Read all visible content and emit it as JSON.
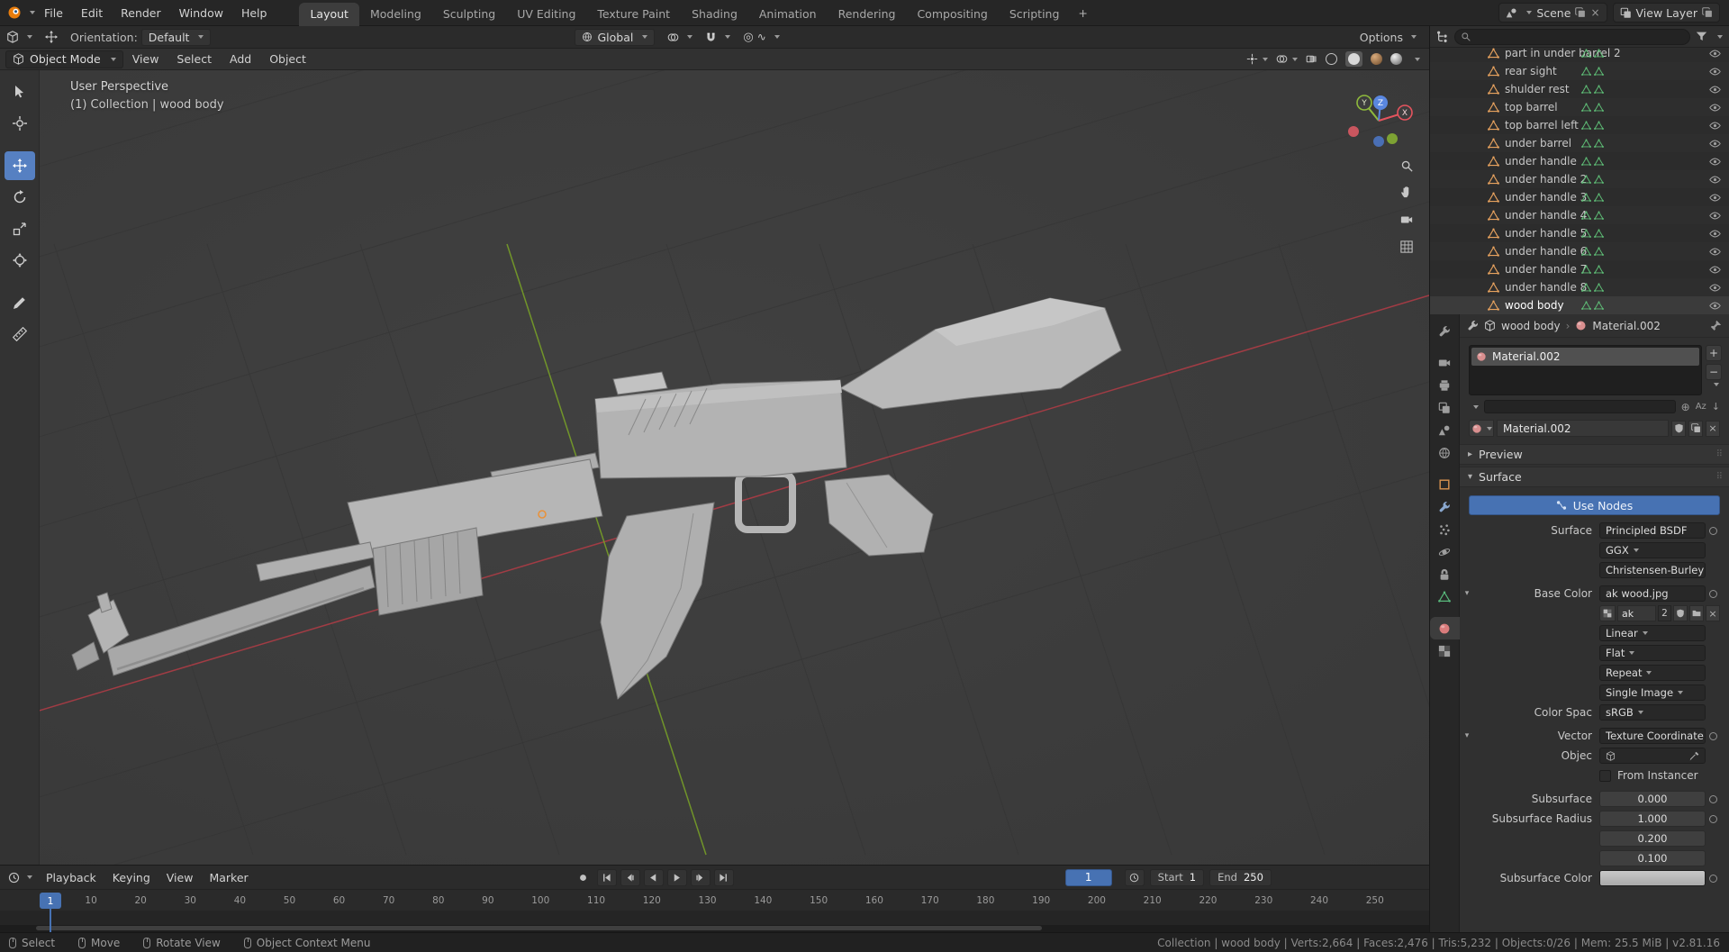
{
  "topbar": {
    "menus": [
      "File",
      "Edit",
      "Render",
      "Window",
      "Help"
    ],
    "workspaces": [
      "Layout",
      "Modeling",
      "Sculpting",
      "UV Editing",
      "Texture Paint",
      "Shading",
      "Animation",
      "Rendering",
      "Compositing",
      "Scripting"
    ],
    "add_workspace": "+",
    "scene_label": "Scene",
    "view_layer_label": "View Layer"
  },
  "tool_settings": {
    "orientation_label": "Orientation:",
    "orientation_value": "Default",
    "pivot": "Global",
    "options": "Options"
  },
  "viewport": {
    "mode": "Object Mode",
    "menus": [
      "View",
      "Select",
      "Add",
      "Object"
    ],
    "overlay_line1": "User Perspective",
    "overlay_line2": "(1) Collection | wood body",
    "gizmo": {
      "x": "X",
      "y": "Y",
      "z": "Z"
    }
  },
  "outliner": {
    "items": [
      "part in under barrel 2",
      "rear sight",
      "shulder rest",
      "top barrel",
      "top barrel left",
      "under barrel",
      "under handle",
      "under handle 2",
      "under handle 3",
      "under handle 4",
      "under handle 5",
      "under handle 6",
      "under handle 7",
      "under handle 8",
      "wood body"
    ]
  },
  "properties": {
    "breadcrumb": {
      "object": "wood body",
      "material": "Material.002"
    },
    "slot": {
      "name": "Material.002",
      "add": "+",
      "remove": "−"
    },
    "datablock": {
      "name": "Material.002"
    },
    "sort_label": "Az",
    "panels": {
      "preview": "Preview",
      "surface": "Surface"
    },
    "use_nodes": "Use Nodes",
    "fields": {
      "surface_label": "Surface",
      "surface_value": "Principled BSDF",
      "distribution": "GGX",
      "subsurface_method": "Christensen-Burley",
      "base_color_label": "Base Color",
      "base_color_value": "ak wood.jpg",
      "image_name": "ak",
      "image_users": "2",
      "interpolation": "Linear",
      "projection": "Flat",
      "extension": "Repeat",
      "source": "Single Image",
      "color_space_label": "Color Spac",
      "color_space_value": "sRGB",
      "vector_label": "Vector",
      "vector_value": "Texture Coordinate | ..",
      "object_label": "Objec",
      "from_instancer": "From Instancer",
      "subsurface_label": "Subsurface",
      "subsurface_value": "0.000",
      "radius_label": "Subsurface Radius",
      "radius_values": [
        "1.000",
        "0.200",
        "0.100"
      ],
      "subsurface_color_label": "Subsurface Color"
    }
  },
  "timeline": {
    "menus": [
      "Playback",
      "Keying",
      "View",
      "Marker"
    ],
    "current_frame": "1",
    "start_label": "Start",
    "start_value": "1",
    "end_label": "End",
    "end_value": "250",
    "ruler_labels": [
      "1",
      "10",
      "20",
      "30",
      "40",
      "50",
      "60",
      "70",
      "80",
      "90",
      "100",
      "110",
      "120",
      "130",
      "140",
      "150",
      "160",
      "170",
      "180",
      "190",
      "200",
      "210",
      "220",
      "230",
      "240",
      "250"
    ]
  },
  "statusbar": {
    "hints": [
      "Select",
      "Move",
      "Rotate View",
      "Object Context Menu"
    ],
    "stats": "Collection | wood body | Verts:2,664 | Faces:2,476 | Tris:5,232 | Objects:0/26 | Mem: 25.5 MiB | v2.81.16"
  },
  "colors": {
    "accent": "#4772b3",
    "axis_x": "#e5545e",
    "axis_y": "#9bcf3a",
    "axis_z": "#5a87e0",
    "mesh_icon": "#e8a35f"
  }
}
